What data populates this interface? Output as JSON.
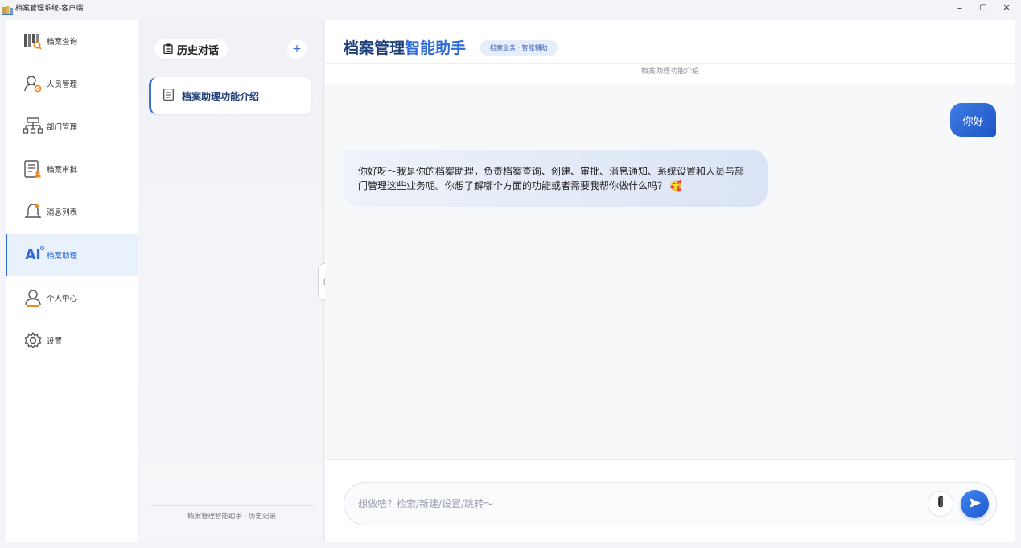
{
  "window": {
    "title": "档案管理系统-客户端",
    "controls": {
      "minimize": "–",
      "maximize": "▢",
      "close": "✕"
    }
  },
  "nav": {
    "items": [
      {
        "label": "档案查询",
        "icon": "archive-search-icon"
      },
      {
        "label": "人员管理",
        "icon": "user-gear-icon"
      },
      {
        "label": "部门管理",
        "icon": "org-chart-icon"
      },
      {
        "label": "档案审批",
        "icon": "document-approval-icon"
      },
      {
        "label": "消息列表",
        "icon": "bell-icon"
      },
      {
        "label": "档案助理",
        "icon": "ai-icon",
        "active": true
      },
      {
        "label": "个人中心",
        "icon": "person-icon"
      },
      {
        "label": "设置",
        "icon": "gear-icon"
      }
    ],
    "ai_icon_text": "AI"
  },
  "history": {
    "title": "历史对话",
    "add_label": "+",
    "items": [
      {
        "label": "档案助理功能介绍"
      }
    ],
    "footer": "档案管理智能助手 · 历史记录",
    "collapse_label": "⟨"
  },
  "chat": {
    "title_part1": "档案管理",
    "title_part2": "智能助手",
    "badge": "档案业务 · 智能辅助",
    "subtitle": "档案助理功能介绍",
    "messages": [
      {
        "role": "user",
        "text": "你好"
      },
      {
        "role": "assistant",
        "text": "你好呀～我是你的档案助理，负责档案查询、创建、审批、消息通知、系统设置和人员与部门管理这些业务呢。你想了解哪个方面的功能或者需要我帮你做什么吗？ 🥰"
      }
    ],
    "input": {
      "value": "",
      "placeholder": "想做啥？检索/新建/设置/跳转～"
    }
  },
  "colors": {
    "accent": "#2f6bd8",
    "title_dark": "#1f3f7a",
    "active_nav_bg": "#e9f1fd"
  }
}
